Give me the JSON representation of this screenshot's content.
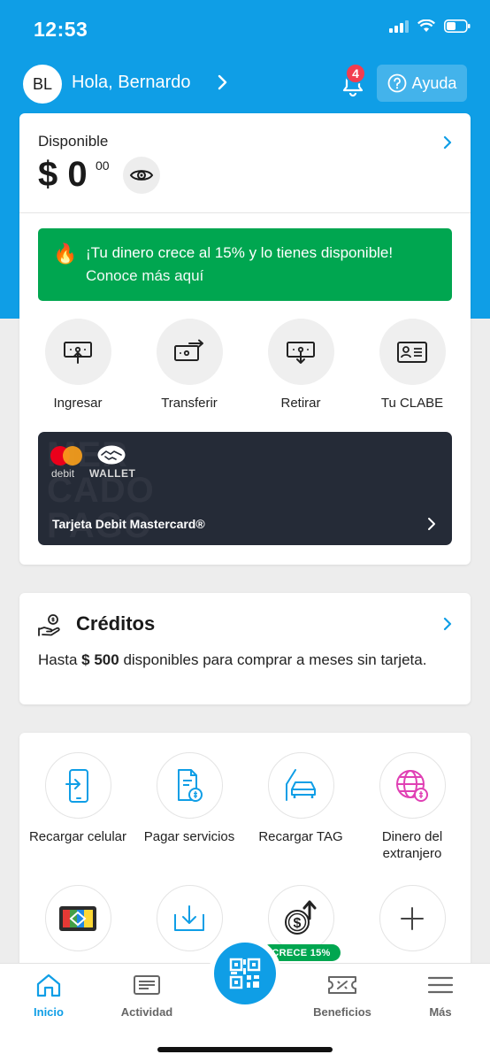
{
  "status_bar": {
    "time": "12:53"
  },
  "header": {
    "avatar_initials": "BL",
    "greeting": "Hola, Bernardo",
    "notifications_count": "4",
    "help_label": "Ayuda"
  },
  "balance": {
    "label": "Disponible",
    "currency_amount": "$ 0",
    "cents": "00"
  },
  "promo": {
    "icon": "🔥",
    "title": "¡Tu dinero crece al 15% y lo tienes disponible!",
    "link": "Conoce más aquí",
    "color": "#00a650"
  },
  "actions": [
    {
      "label": "Ingresar",
      "icon": "deposit-icon"
    },
    {
      "label": "Transferir",
      "icon": "transfer-icon"
    },
    {
      "label": "Retirar",
      "icon": "withdraw-icon"
    },
    {
      "label": "Tu CLABE",
      "icon": "id-card-icon"
    }
  ],
  "debit_card": {
    "brand_text": "debit",
    "wallet_text": "WALLET",
    "watermark": "MER CADO PAGO",
    "name": "Tarjeta Debit Mastercard®"
  },
  "credits": {
    "title": "Créditos",
    "desc_prefix": "Hasta",
    "desc_amount": "$ 500",
    "desc_suffix": "disponibles para comprar a meses sin tarjeta."
  },
  "services": [
    {
      "label": "Recargar celular",
      "icon": "phone-recharge-icon"
    },
    {
      "label": "Pagar servicios",
      "icon": "bill-icon"
    },
    {
      "label": "Recargar TAG",
      "icon": "car-tag-icon"
    },
    {
      "label": "Dinero del extranjero",
      "icon": "globe-money-icon"
    },
    {
      "label": "",
      "icon": "transport-card-icon"
    },
    {
      "label": "",
      "icon": "download-tray-icon"
    },
    {
      "label": "",
      "icon": "coin-growth-icon"
    },
    {
      "label": "",
      "icon": "plus-icon"
    }
  ],
  "crece_badge": "CRECE 15%",
  "tabbar": [
    {
      "label": "Inicio",
      "icon": "home-icon",
      "active": true
    },
    {
      "label": "Actividad",
      "icon": "activity-icon"
    },
    {
      "label": "Beneficios",
      "icon": "ticket-icon"
    },
    {
      "label": "Más",
      "icon": "menu-icon"
    }
  ],
  "colors": {
    "brand_blue": "#0f9ee6",
    "green": "#00a650",
    "badge_red": "#f23d4f",
    "card_dark": "#252b37"
  }
}
